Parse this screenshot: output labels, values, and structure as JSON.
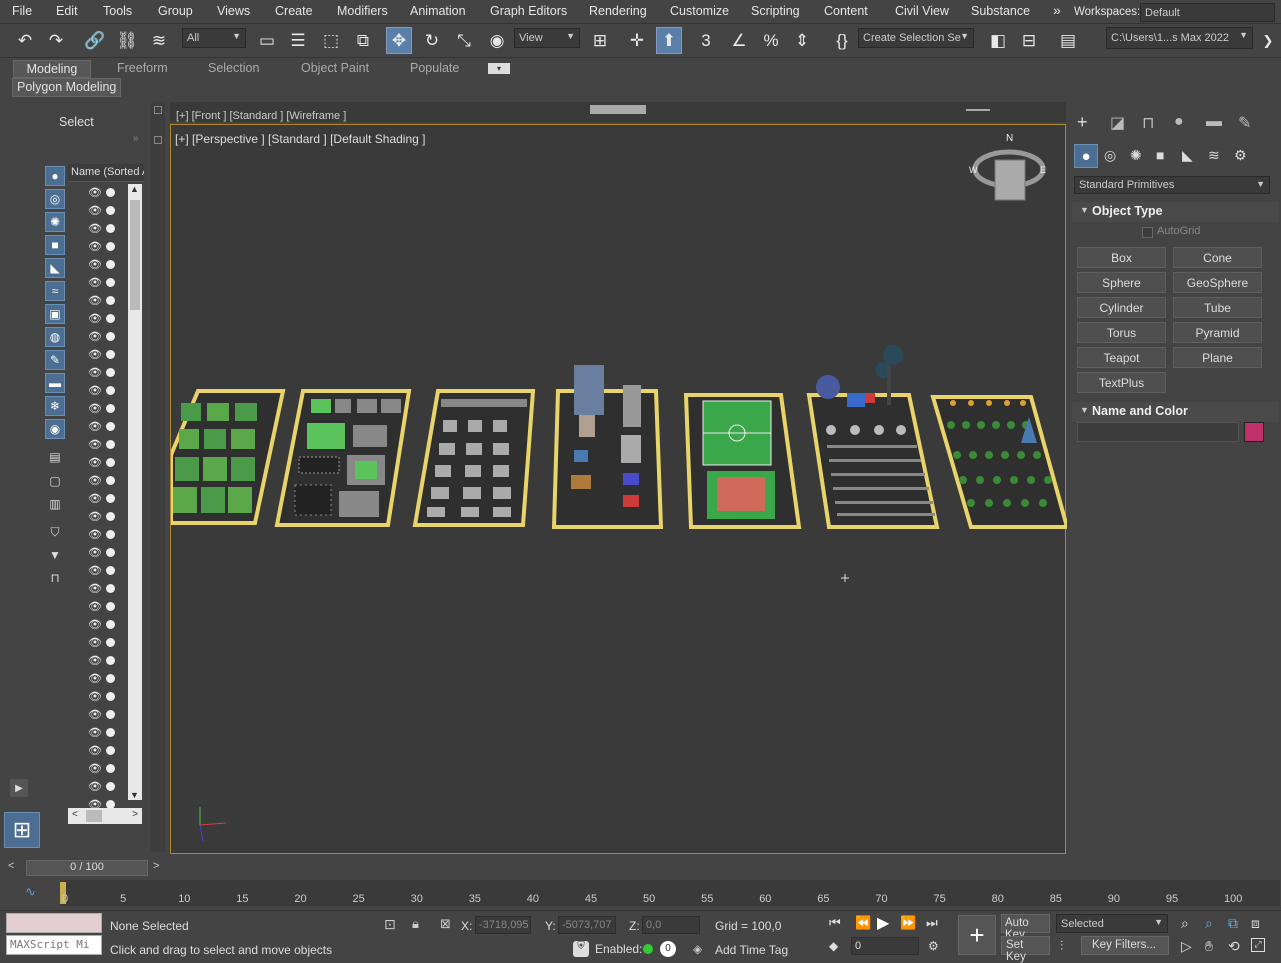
{
  "menu": [
    "File",
    "Edit",
    "Tools",
    "Group",
    "Views",
    "Create",
    "Modifiers",
    "Animation",
    "Graph Editors",
    "Rendering",
    "Customize",
    "Scripting",
    "Content",
    "Civil View",
    "Substance"
  ],
  "menu_overflow": "»",
  "workspaces_label": "Workspaces:",
  "workspaces_value": "Default",
  "toolbar": {
    "selection_filter": "All",
    "ref_coord": "View",
    "create_selection_set": "Create Selection Se",
    "project_path": "C:\\Users\\1...s Max 2022"
  },
  "ribbon_tabs": [
    "Modeling",
    "Freeform",
    "Selection",
    "Object Paint",
    "Populate"
  ],
  "ribbon_sub": "Polygon Modeling",
  "scene_explorer": {
    "select_label": "Select",
    "column_header": "Name (Sorted A"
  },
  "viewport": {
    "label": "[+] [Perspective ] [Standard ] [Default Shading ]",
    "other_label": "[+] [Front ] [Standard ] [Wireframe ]",
    "viewcube": {
      "north": "N",
      "west": "W",
      "east": "E"
    }
  },
  "command_panel": {
    "category": "Standard Primitives",
    "object_type_title": "Object Type",
    "autogrid": "AutoGrid",
    "buttons": [
      "Box",
      "Cone",
      "Sphere",
      "GeoSphere",
      "Cylinder",
      "Tube",
      "Torus",
      "Pyramid",
      "Teapot",
      "Plane",
      "TextPlus"
    ],
    "name_color_title": "Name and Color",
    "object_color": "#c0306a"
  },
  "timeline": {
    "frame_display": "0 / 100",
    "ticks": [
      "0",
      "5",
      "10",
      "15",
      "20",
      "25",
      "30",
      "35",
      "40",
      "45",
      "50",
      "55",
      "60",
      "65",
      "70",
      "75",
      "80",
      "85",
      "90",
      "95",
      "100"
    ]
  },
  "status": {
    "maxscript_placeholder": "MAXScript Mi",
    "selection": "None Selected",
    "prompt": "Click and drag to select and move objects",
    "x_label": "X:",
    "x_value": "-3718,095",
    "y_label": "Y:",
    "y_value": "-5073,707",
    "z_label": "Z:",
    "z_value": "0,0",
    "grid": "Grid = 100,0",
    "enabled_label": "Enabled:",
    "enabled_value": "0",
    "add_time_tag": "Add Time Tag",
    "auto_key": "Auto Key",
    "set_key": "Set Key",
    "key_mode": "Selected",
    "key_filters": "Key Filters...",
    "current_frame": "0"
  }
}
